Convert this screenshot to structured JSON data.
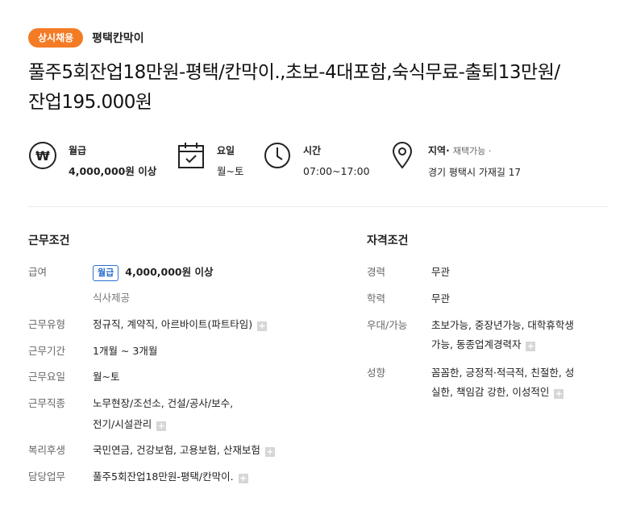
{
  "header": {
    "badge": "상시채용",
    "company": "평택칸막이"
  },
  "title_line1": "풀주5회잔업18만원-평택/칸막이.,초보-4대포함,숙식무료-출퇴13만원/",
  "title_line2": "잔업195.000원",
  "summary": {
    "pay": {
      "icon": "won-icon",
      "label": "월급",
      "value": "4,000,000원 이상"
    },
    "days": {
      "icon": "calendar-check-icon",
      "label": "요일",
      "value": "월~토"
    },
    "time": {
      "icon": "clock-icon",
      "label": "시간",
      "value": "07:00~17:00"
    },
    "region": {
      "icon": "location-pin-icon",
      "label": "지역",
      "label_sep": "·",
      "extra": "재택가능 ·",
      "value": "경기 평택시 가재길 17"
    }
  },
  "work": {
    "title": "근무조건",
    "pay_label": "급여",
    "pay_tag": "월급",
    "pay_value": "4,000,000원 이상",
    "pay_sub": "식사제공",
    "type_label": "근무유형",
    "type_value": "정규직, 계약직, 아르바이트(파트타임)",
    "period_label": "근무기간",
    "period_value": "1개월 ~ 3개월",
    "days_label": "근무요일",
    "days_value": "월~토",
    "job_label": "근무직종",
    "job_value_1": "노무현장/조선소, 건설/공사/보수,",
    "job_value_2": "전기/시설관리",
    "welfare_label": "복리후생",
    "welfare_value": "국민연금, 건강보험, 고용보험, 산재보험",
    "duty_label": "담당업무",
    "duty_value": "풀주5회잔업18만원-평택/칸막이."
  },
  "qual": {
    "title": "자격조건",
    "career_label": "경력",
    "career_value": "무관",
    "edu_label": "학력",
    "edu_value": "무관",
    "pref_label": "우대/가능",
    "pref_value_1": "초보가능, 중장년가능, 대학휴학생",
    "pref_value_2": "가능, 동종업계경력자",
    "trait_label": "성향",
    "trait_value_1": "꼼꼼한, 긍정적·적극적, 친절한, 성",
    "trait_value_2": "실한, 책임감 강한, 이성적인"
  },
  "colors": {
    "badge": "#f47b25",
    "tag": "#2b6fce"
  }
}
